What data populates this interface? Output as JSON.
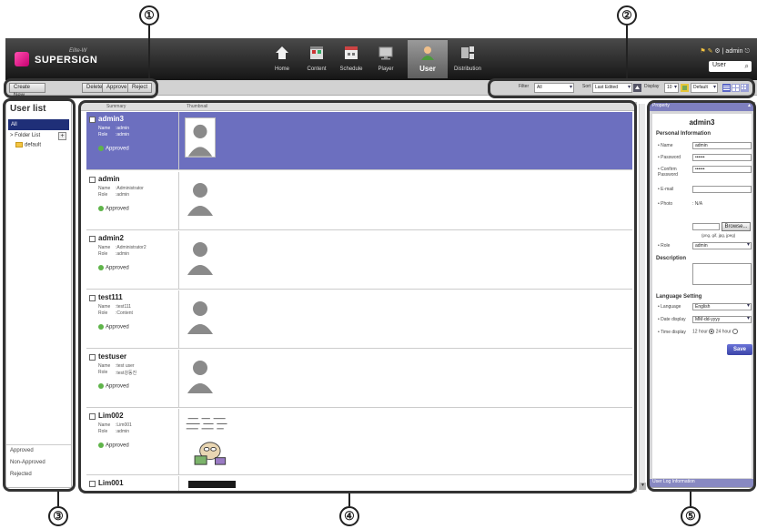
{
  "callouts": [
    "①",
    "②",
    "③",
    "④",
    "⑤"
  ],
  "header": {
    "logo_text": "SUPERSIGN",
    "logo_sub": "Elite-W",
    "nav": [
      {
        "label": "Home",
        "icon": "home-icon"
      },
      {
        "label": "Content",
        "icon": "content-icon"
      },
      {
        "label": "Schedule",
        "icon": "schedule-icon"
      },
      {
        "label": "Player",
        "icon": "player-icon"
      },
      {
        "label": "User",
        "icon": "user-icon"
      },
      {
        "label": "Distribution",
        "icon": "distribution-icon"
      }
    ],
    "user_menu": "| admin",
    "search_value": "User"
  },
  "toolbar": {
    "create_new": "Create New",
    "delete": "Delete",
    "approve": "Approve",
    "reject": "Reject",
    "filter_label": "Filter",
    "filter_value": "All",
    "sort_label": "Sort",
    "sort_value": "Last Edited",
    "display_label": "Display",
    "display_value": "10",
    "view_value": "Default"
  },
  "left_panel": {
    "title": "User list",
    "all": "All",
    "folder_list": "> Folder List",
    "add_symbol": "+",
    "default_folder": "default",
    "filters": [
      "Approved",
      "Non-Approved",
      "Rejected"
    ]
  },
  "main": {
    "header_col1": "Summary",
    "header_col2": "Thumbnail",
    "name_label": "Name",
    "role_label": "Role",
    "users": [
      {
        "id": "admin3",
        "name": ":admin",
        "role": ":admin",
        "status": "Approved"
      },
      {
        "id": "admin",
        "name": ":Administrator",
        "role": ":admin",
        "status": "Approved"
      },
      {
        "id": "admin2",
        "name": ":Administrator2",
        "role": ":admin",
        "status": "Approved"
      },
      {
        "id": "test111",
        "name": ":test111",
        "role": ":Content",
        "status": "Approved"
      },
      {
        "id": "testuser",
        "name": ":test user",
        "role": ":test강동진",
        "status": "Approved"
      },
      {
        "id": "Lim002",
        "name": ":Lim001",
        "role": ":admin",
        "status": "Approved"
      },
      {
        "id": "Lim001"
      }
    ]
  },
  "property": {
    "header": "Property",
    "user_name": "admin3",
    "personal_info": "Personal Information",
    "name_label": "• Name",
    "name_value": "admin",
    "password_label": "• Password",
    "password_value": "••••••",
    "confirm_label": "• Confirm Password",
    "confirm_value": "••••••",
    "email_label": "• E-mail",
    "photo_label": "• Photo",
    "photo_value": ": N/A",
    "browse": "Browse...",
    "photo_hint": "(png, gif, jpg, jpeg)",
    "role_label": "• Role",
    "role_value": "admin",
    "description": "Description",
    "language_setting": "Language Setting",
    "language_label": "• Language",
    "language_value": "English",
    "date_label": "• Date display",
    "date_value": "MM-dd-yyyy",
    "time_label": "• Time display",
    "time_12": "12 hour",
    "time_24": "24 hour",
    "save": "Save",
    "footer": "User Log Information"
  }
}
